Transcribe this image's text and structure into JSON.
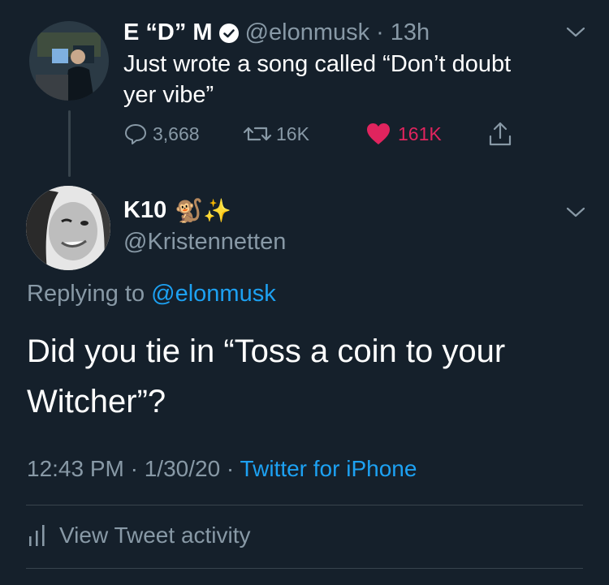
{
  "parent_tweet": {
    "display_name": "E “D” M",
    "handle": "@elonmusk",
    "time": "13h",
    "text_line1": "Just wrote a song called “Don’t doubt",
    "text_line2": "yer vibe”",
    "replies": "3,668",
    "retweets": "16K",
    "likes": "161K",
    "like_color": "#e0245e"
  },
  "reply_tweet": {
    "display_name": "K10",
    "name_emojis": "🐒✨",
    "handle": "@Kristennetten",
    "replying_prefix": "Replying to",
    "replying_to": "@elonmusk",
    "text_line1": "Did you tie in “Toss a coin to your",
    "text_line2": "Witcher”?",
    "timestamp": "12:43 PM · 1/30/20 ·",
    "source": "Twitter for iPhone",
    "activity_label": "View Tweet activity"
  },
  "colors": {
    "background": "#15202b",
    "secondary_text": "#8899a6",
    "accent": "#1da1f2",
    "divider": "#38444d"
  }
}
